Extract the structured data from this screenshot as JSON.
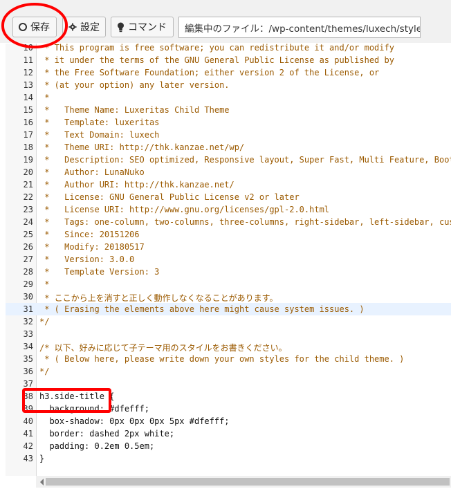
{
  "toolbar": {
    "save_label": "保存",
    "settings_label": "設定",
    "command_label": "コマンド",
    "file_field_value": "編集中のファイル：/wp-content/themes/luxech/style.css"
  },
  "editor": {
    "lines": [
      {
        "n": "10",
        "text": " * This program is free software; you can redistribute it and/or modify",
        "cls": "c-comment"
      },
      {
        "n": "11",
        "text": " * it under the terms of the GNU General Public License as published by",
        "cls": "c-comment"
      },
      {
        "n": "12",
        "text": " * the Free Software Foundation; either version 2 of the License, or",
        "cls": "c-comment"
      },
      {
        "n": "13",
        "text": " * (at your option) any later version.",
        "cls": "c-comment"
      },
      {
        "n": "14",
        "text": " *",
        "cls": "c-comment"
      },
      {
        "n": "15",
        "text": " *   Theme Name: Luxeritas Child Theme",
        "cls": "c-comment"
      },
      {
        "n": "16",
        "text": " *   Template: luxeritas",
        "cls": "c-comment"
      },
      {
        "n": "17",
        "text": " *   Text Domain: luxech",
        "cls": "c-comment"
      },
      {
        "n": "18",
        "text": " *   Theme URI: http://thk.kanzae.net/wp/",
        "cls": "c-comment"
      },
      {
        "n": "19",
        "text": " *   Description: SEO optimized, Responsive layout, Super Fast, Multi Feature, Bootstrap",
        "cls": "c-comment"
      },
      {
        "n": "20",
        "text": " *   Author: LunaNuko",
        "cls": "c-comment"
      },
      {
        "n": "21",
        "text": " *   Author URI: http://thk.kanzae.net/",
        "cls": "c-comment"
      },
      {
        "n": "22",
        "text": " *   License: GNU General Public License v2 or later",
        "cls": "c-comment"
      },
      {
        "n": "23",
        "text": " *   License URI: http://www.gnu.org/licenses/gpl-2.0.html",
        "cls": "c-comment"
      },
      {
        "n": "24",
        "text": " *   Tags: one-column, two-columns, three-columns, right-sidebar, left-sidebar, custom-header",
        "cls": "c-comment"
      },
      {
        "n": "25",
        "text": " *   Since: 20151206",
        "cls": "c-comment"
      },
      {
        "n": "26",
        "text": " *   Modify: 20180517",
        "cls": "c-comment"
      },
      {
        "n": "27",
        "text": " *   Version: 3.0.0",
        "cls": "c-comment"
      },
      {
        "n": "28",
        "text": " *   Template Version: 3",
        "cls": "c-comment"
      },
      {
        "n": "29",
        "text": " *",
        "cls": "c-comment"
      },
      {
        "n": "30",
        "text": " * ここから上を消すと正しく動作しなくなることがあります。",
        "cls": "c-comment"
      },
      {
        "n": "31",
        "text": " * ( Erasing the elements above here might cause system issues. )",
        "cls": "c-comment",
        "active": true
      },
      {
        "n": "32",
        "text": "*/",
        "cls": "c-comment"
      },
      {
        "n": "33",
        "text": "",
        "cls": ""
      },
      {
        "n": "34",
        "text": "/* 以下、好みに応じて子テーマ用のスタイルをお書きください。",
        "cls": "c-comment"
      },
      {
        "n": "35",
        "text": " * ( Below here, please write down your own styles for the child theme. )",
        "cls": "c-comment"
      },
      {
        "n": "36",
        "text": "*/",
        "cls": "c-comment"
      },
      {
        "n": "37",
        "text": "",
        "cls": ""
      },
      {
        "n": "38",
        "text": "h3.side-title {",
        "cls": "c-key"
      },
      {
        "n": "39",
        "text": "  background: #dfefff;",
        "cls": "c-key"
      },
      {
        "n": "40",
        "text": "  box-shadow: 0px 0px 0px 5px #dfefff;",
        "cls": "c-key"
      },
      {
        "n": "41",
        "text": "  border: dashed 2px white;",
        "cls": "c-key"
      },
      {
        "n": "42",
        "text": "  padding: 0.2em 0.5em;",
        "cls": "c-key"
      },
      {
        "n": "43",
        "text": "}",
        "cls": "c-key"
      }
    ]
  },
  "colors": {
    "annotation": "#ff0000",
    "comment": "#9b5a00",
    "active_line": "#e8f2ff"
  },
  "icons": {
    "save": "circle-icon",
    "settings": "gear-icon",
    "command": "lightbulb-icon",
    "scroll_left": "arrow-left-icon"
  }
}
